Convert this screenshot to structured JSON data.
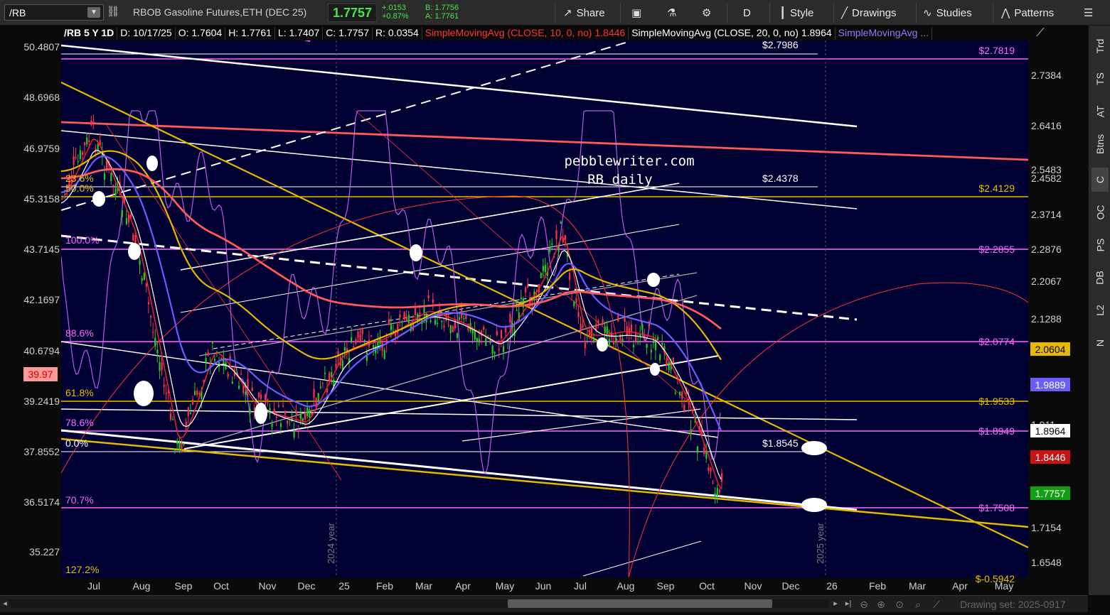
{
  "toolbar": {
    "symbol": "/RB",
    "description": "RBOB Gasoline Futures,ETH (DEC 25)",
    "last": "1.7757",
    "change": "+.0153",
    "change_pct": "+0.87%",
    "bid": "B: 1.7756",
    "ask": "A: 1.7761",
    "share_label": "Share",
    "period_label": "D",
    "style_label": "Style",
    "drawings_label": "Drawings",
    "studies_label": "Studies",
    "patterns_label": "Patterns"
  },
  "info_bar": {
    "timeframe": "/RB 5 Y 1D",
    "date": "D: 10/17/25",
    "open": "O: 1.7604",
    "high": "H: 1.7761",
    "low": "L: 1.7407",
    "close": "C: 1.7757",
    "range": "R: 0.0354",
    "sma10": "SimpleMovingAvg (CLOSE, 10, 0, no)",
    "sma10_val": "1.8446",
    "sma20": "SimpleMovingAvg (CLOSE, 20, 0, no)",
    "sma20_val": "1.8964",
    "sma_more": "SimpleMovingAvg ..."
  },
  "watermark": {
    "line1": "pebblewriter.com",
    "line2": "RB daily"
  },
  "chart_data": {
    "type": "candlestick",
    "x_labels": [
      "Jul",
      "Aug",
      "Sep",
      "Oct",
      "Nov",
      "Dec",
      "25",
      "Feb",
      "Mar",
      "Apr",
      "May",
      "Jun",
      "Jul",
      "Aug",
      "Sep",
      "Oct",
      "Nov",
      "Dec",
      "26",
      "Feb",
      "Mar",
      "Apr",
      "May"
    ],
    "left_axis": [
      "50.4807",
      "48.6968",
      "46.9759",
      "45.3158",
      "43.7145",
      "42.1697",
      "40.6794",
      "39.2419",
      "37.8552",
      "36.5174",
      "35.227"
    ],
    "left_axis_marker": "39.97",
    "right_axis": [
      "2.7384",
      "2.6416",
      "2.5483",
      "2.4582",
      "2.3714",
      "2.2876",
      "2.2067",
      "2.1288",
      "2.0604",
      "1.911",
      "1.8964",
      "1.8446",
      "1.7757",
      "1.7154",
      "1.6548"
    ],
    "right_tags": [
      {
        "label": "2.0604",
        "bg": "#e6b800",
        "fg": "#000000"
      },
      {
        "label": "1.9889",
        "bg": "#6a5cff",
        "fg": "#ffffff"
      },
      {
        "label": "1.8964",
        "bg": "#ffffff",
        "fg": "#000000"
      },
      {
        "label": "1.8446",
        "bg": "#c81414",
        "fg": "#ffffff"
      },
      {
        "label": "1.7757",
        "bg": "#12a012",
        "fg": "#ffffff"
      }
    ],
    "fib_levels_right": [
      {
        "label": "$2.7819",
        "color": "#ff66ff"
      },
      {
        "label": "$2.4129",
        "color": "#e6c000"
      },
      {
        "label": "$2.2855",
        "color": "#ff66ff"
      },
      {
        "label": "$2.0774",
        "color": "#ff66ff"
      },
      {
        "label": "$1.9533",
        "color": "#e6c000"
      },
      {
        "label": "$1.8949",
        "color": "#ff66ff"
      },
      {
        "label": "$1.7508",
        "color": "#ff66ff"
      },
      {
        "label": "$-0.5942",
        "color": "#e6c000"
      }
    ],
    "fib_levels_left": [
      {
        "label": "23.6%",
        "color": "#e6c000"
      },
      {
        "label": "50.0%",
        "color": "#e6c000"
      },
      {
        "label": "100.0%",
        "color": "#ff66ff"
      },
      {
        "label": "88.6%",
        "color": "#ff66ff"
      },
      {
        "label": "61.8%",
        "color": "#e6c000"
      },
      {
        "label": "78.6%",
        "color": "#ff66ff"
      },
      {
        "label": "0.0%",
        "color": "#ffffff"
      },
      {
        "label": "70.7%",
        "color": "#ff66ff"
      },
      {
        "label": "127.2%",
        "color": "#e6c000"
      }
    ],
    "white_labels": [
      "$2.7986",
      "$2.4378",
      "$1.8545"
    ],
    "year_labels": [
      "2024 year",
      "2025 year"
    ],
    "colors": {
      "background": "#000033",
      "sma10": "#ff2222",
      "sma20": "#ffffff",
      "sma50": "#6a5cff",
      "sma200": "#e6b800",
      "sma_red": "#ff5a5a",
      "candle_up": "#22cc22",
      "candle_down": "#ff3344",
      "osc": "#cc66ff"
    }
  },
  "side_tabs": [
    "Trd",
    "TS",
    "AT",
    "Btns",
    "C",
    "OC",
    "PS",
    "DB",
    "L2",
    "N"
  ],
  "bottom": {
    "drawing_set": "Drawing set: 2025-0917"
  }
}
